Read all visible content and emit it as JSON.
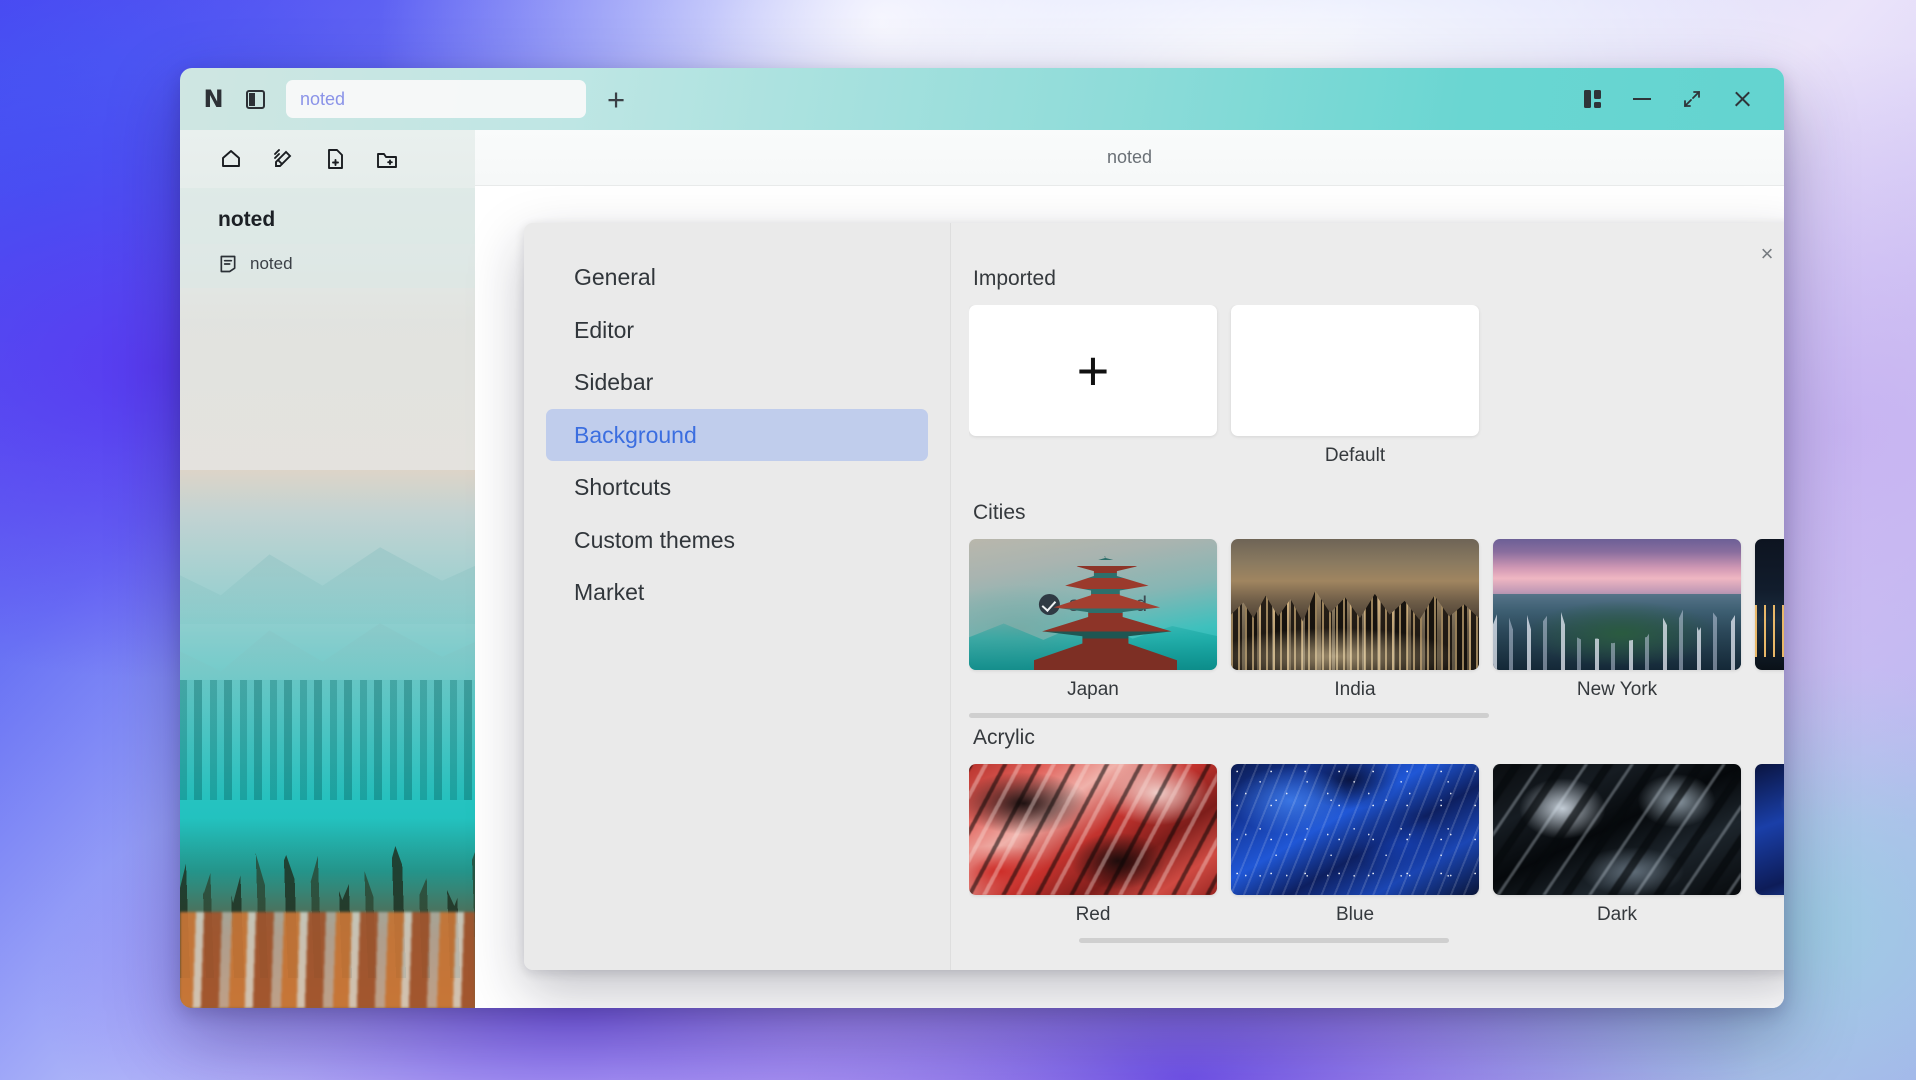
{
  "window": {
    "app_logo": "N",
    "panel_toggle_icon": "sidebar-panel-icon",
    "tab_value": "noted",
    "add_tab_label": "+",
    "controls": {
      "layout_icon": "layout-grid-icon",
      "minimize_icon": "minimize-icon",
      "maximize_icon": "maximize-icon",
      "close_icon": "close-icon"
    }
  },
  "app_sidebar": {
    "toolbar_icons": [
      "home-icon",
      "highlight-pen-icon",
      "new-file-icon",
      "new-folder-icon"
    ],
    "section_title": "noted",
    "note_item": {
      "icon": "note-file-icon",
      "label": "noted"
    }
  },
  "content": {
    "tab_title": "noted"
  },
  "settings": {
    "close_label": "×",
    "nav": [
      {
        "label": "General",
        "active": false
      },
      {
        "label": "Editor",
        "active": false
      },
      {
        "label": "Sidebar",
        "active": false
      },
      {
        "label": "Background",
        "active": true
      },
      {
        "label": "Shortcuts",
        "active": false
      },
      {
        "label": "Custom themes",
        "active": false
      },
      {
        "label": "Market",
        "active": false
      }
    ],
    "active_nav": "Background",
    "accent_color": "#3b6ee0",
    "active_bg_color": "#c0cdec",
    "sections": [
      {
        "title": "Imported",
        "items": [
          {
            "label": "",
            "kind": "add-button",
            "art": "plus",
            "selected": false
          },
          {
            "label": "Default",
            "kind": "thumbnail",
            "art": "blank",
            "selected": false
          }
        ]
      },
      {
        "title": "Cities",
        "items": [
          {
            "label": "Japan",
            "kind": "thumbnail",
            "art": "japan",
            "selected": true
          },
          {
            "label": "India",
            "kind": "thumbnail",
            "art": "india",
            "selected": false
          },
          {
            "label": "New York",
            "kind": "thumbnail",
            "art": "ny",
            "selected": false
          },
          {
            "label": "",
            "kind": "thumbnail",
            "art": "cut",
            "selected": false
          }
        ]
      },
      {
        "title": "Acrylic",
        "items": [
          {
            "label": "Red",
            "kind": "thumbnail",
            "art": "red",
            "selected": false
          },
          {
            "label": "Blue",
            "kind": "thumbnail",
            "art": "blue",
            "selected": false
          },
          {
            "label": "Dark",
            "kind": "thumbnail",
            "art": "dark",
            "selected": false
          },
          {
            "label": "",
            "kind": "thumbnail",
            "art": "bluecut",
            "selected": false
          }
        ]
      }
    ],
    "selected_badge_text": "selected"
  }
}
